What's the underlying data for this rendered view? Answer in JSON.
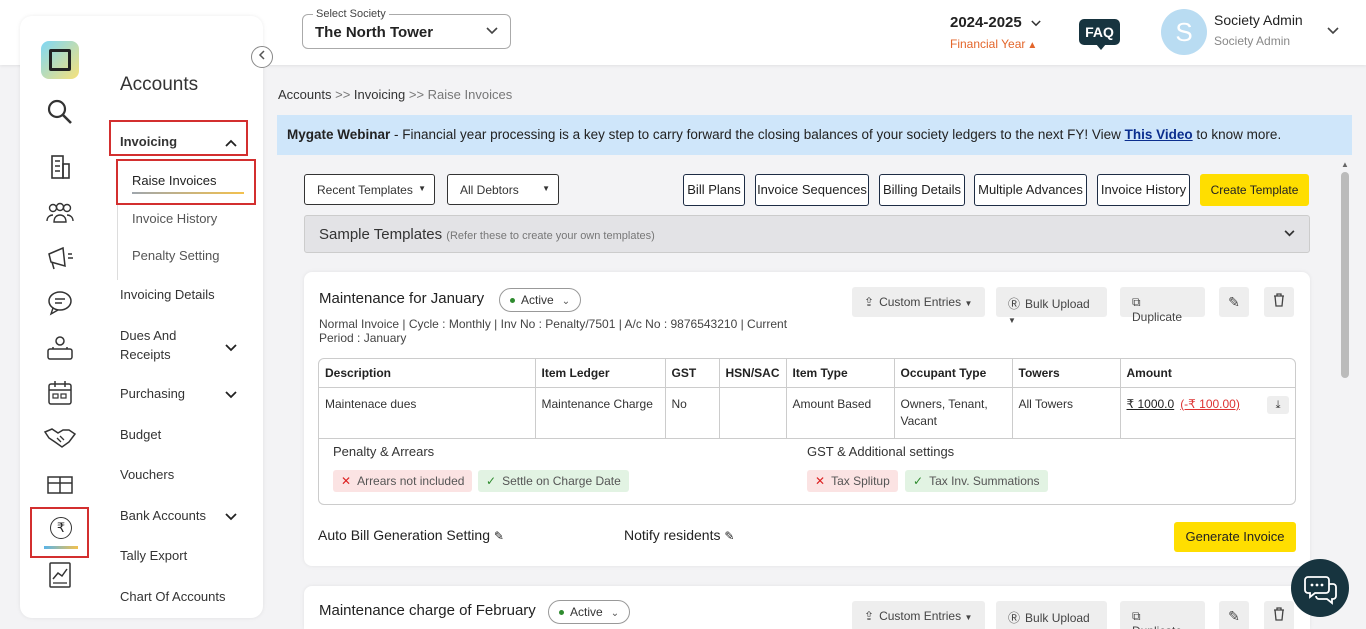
{
  "header": {
    "society_label": "Select Society",
    "society_value": "The North Tower",
    "fy_year": "2024-2025",
    "fy_label": "Financial Year",
    "faq": "FAQ",
    "avatar_initial": "S",
    "user_name": "Society Admin",
    "user_role": "Society Admin"
  },
  "sidebar": {
    "title": "Accounts",
    "items": {
      "invoicing": "Invoicing",
      "raise_invoices": "Raise Invoices",
      "invoice_history": "Invoice History",
      "penalty_setting": "Penalty Setting",
      "invoicing_details": "Invoicing Details",
      "dues_line1": "Dues And",
      "dues_line2": "Receipts",
      "purchasing": "Purchasing",
      "budget": "Budget",
      "vouchers": "Vouchers",
      "bank_accounts": "Bank Accounts",
      "tally_export": "Tally Export",
      "chart_of_accounts": "Chart Of Accounts"
    }
  },
  "breadcrumb": {
    "accounts": "Accounts",
    "invoicing": "Invoicing",
    "current": "Raise Invoices",
    "sep": ">>"
  },
  "banner": {
    "bold": "Mygate Webinar",
    "text": " - Financial year processing is a key step to carry forward the closing balances of your society ledgers to the next FY! View ",
    "link": "This Video",
    "tail": " to know more."
  },
  "toolbar": {
    "recent_templates": "Recent Templates",
    "all_debtors": "All Debtors",
    "bill_plans": "Bill Plans",
    "invoice_sequences": "Invoice Sequences",
    "billing_details": "Billing Details",
    "multiple_advances": "Multiple Advances",
    "invoice_history": "Invoice History",
    "create_template": "Create Template"
  },
  "sample": {
    "title": "Sample Templates",
    "hint": "(Refer these to create your own templates)"
  },
  "card_actions": {
    "custom_entries": "Custom Entries",
    "bulk_upload": "Bulk Upload",
    "duplicate": "Duplicate"
  },
  "card1": {
    "title": "Maintenance for January",
    "status": "Active",
    "meta": "Normal Invoice | Cycle : Monthly | Inv No : Penalty/7501 | A/c No : 9876543210 | Current Period : January",
    "columns": [
      "Description",
      "Item Ledger",
      "GST",
      "HSN/SAC",
      "Item Type",
      "Occupant Type",
      "Towers",
      "Amount"
    ],
    "row": {
      "description": "Maintenace dues",
      "ledger": "Maintenance Charge",
      "gst": "No",
      "hsn": "",
      "item_type": "Amount Based",
      "occupant": "Owners, Tenant, Vacant",
      "towers": "All Towers",
      "amount": "₹ 1000.0",
      "amount_neg": "(-₹ 100.00)"
    },
    "penalty_title": "Penalty & Arrears",
    "penalty_tag1": "Arrears not included",
    "penalty_tag2": "Settle on Charge Date",
    "gst_title": "GST & Additional settings",
    "gst_tag1": "Tax Splitup",
    "gst_tag2": "Tax Inv. Summations",
    "auto_bill": "Auto Bill Generation Setting",
    "notify": "Notify residents",
    "generate": "Generate Invoice"
  },
  "card2": {
    "title": "Maintenance charge of February",
    "status": "Active"
  },
  "colors": {
    "accent_yellow": "#ffde00",
    "dark_teal": "#17343f",
    "highlight_red": "#d32f2f",
    "banner_blue": "#cfe6fa"
  }
}
